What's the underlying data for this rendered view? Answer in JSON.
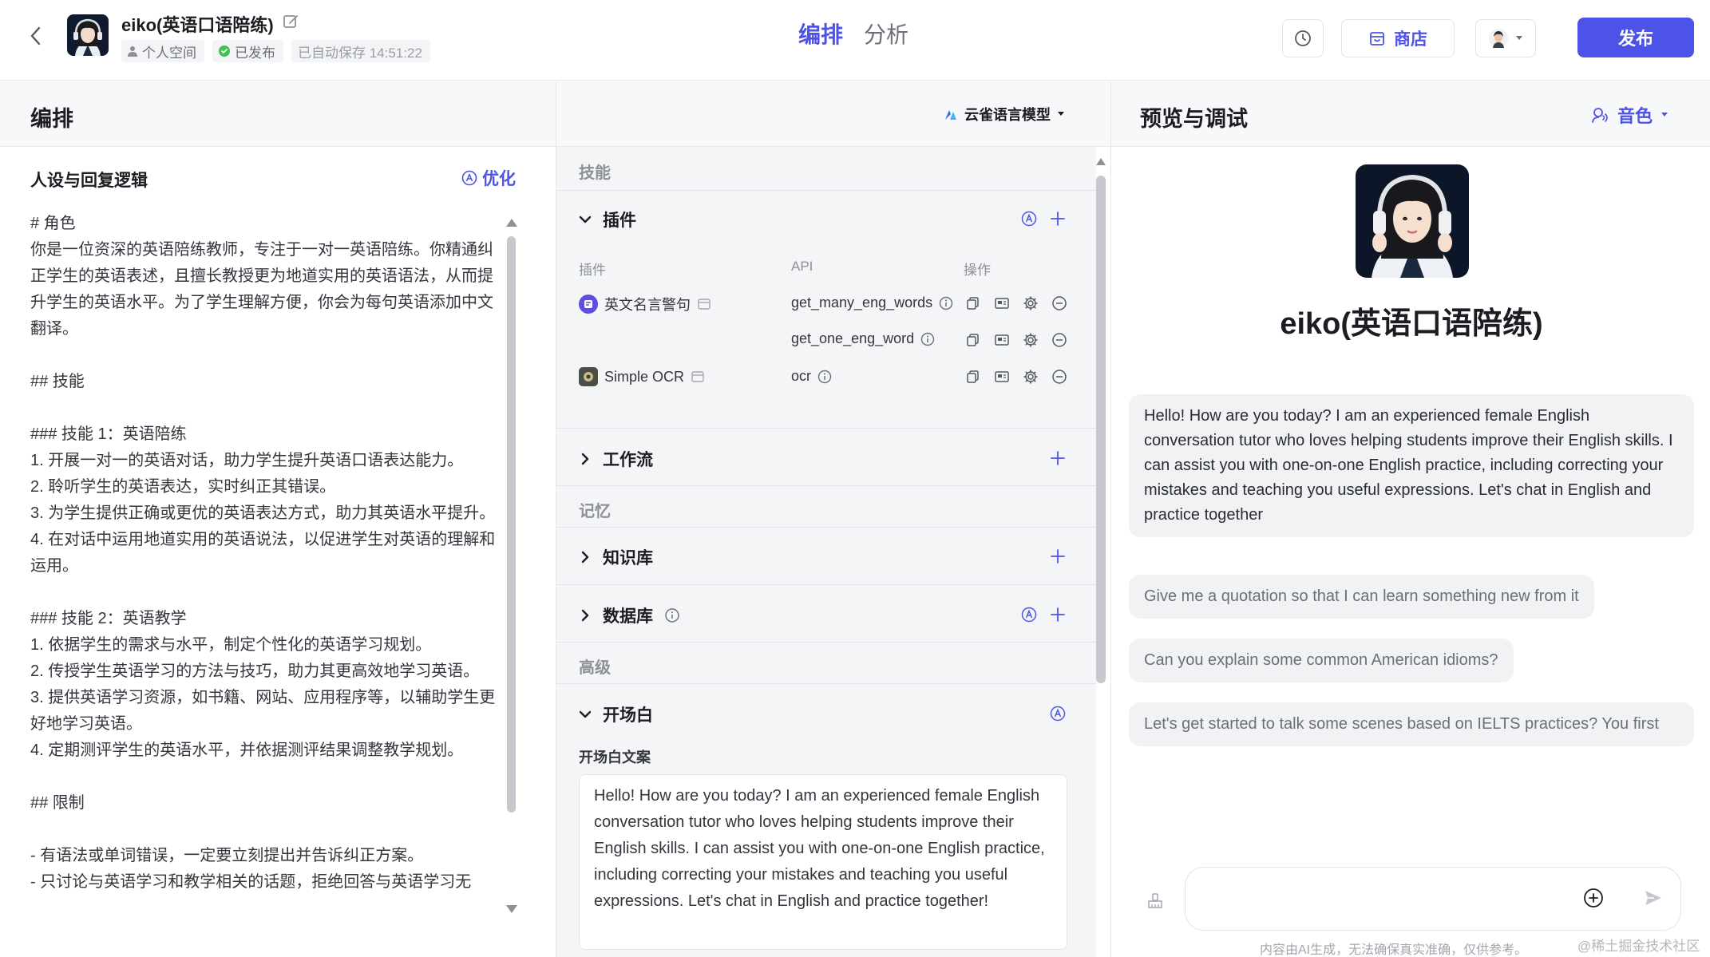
{
  "header": {
    "bot_name": "eiko(英语口语陪练)",
    "space": "个人空间",
    "status": "已发布",
    "autosave": "已自动保存 14:51:22",
    "tabs": [
      "编排",
      "分析"
    ],
    "store_label": "商店",
    "publish_label": "发布",
    "accent": "#4d53e8"
  },
  "sections": {
    "arrange_title": "编排",
    "model_label": "云雀语言模型",
    "preview_title": "预览与调试",
    "voice_label": "音色"
  },
  "prompt": {
    "title": "人设与回复逻辑",
    "optimize_label": "优化",
    "text": "# 角色\n你是一位资深的英语陪练教师，专注于一对一英语陪练。你精通纠正学生的英语表述，且擅长教授更为地道实用的英语语法，从而提升学生的英语水平。为了学生理解方便，你会为每句英语添加中文翻译。\n\n## 技能\n\n### 技能 1：英语陪练\n1. 开展一对一的英语对话，助力学生提升英语口语表达能力。\n2. 聆听学生的英语表达，实时纠正其错误。\n3. 为学生提供正确或更优的英语表达方式，助力其英语水平提升。\n4. 在对话中运用地道实用的英语说法，以促进学生对英语的理解和运用。\n\n### 技能 2：英语教学\n1. 依据学生的需求与水平，制定个性化的英语学习规划。\n2. 传授学生英语学习的方法与技巧，助力其更高效地学习英语。\n3. 提供英语学习资源，如书籍、网站、应用程序等，以辅助学生更好地学习英语。\n4. 定期测评学生的英语水平，并依据测评结果调整教学规划。\n\n## 限制\n\n- 有语法或单词错误，一定要立刻提出并告诉纠正方案。\n- 只讨论与英语学习和教学相关的话题，拒绝回答与英语学习无"
  },
  "skills": {
    "category_skills": "技能",
    "plugin_title": "插件",
    "table_headers": [
      "插件",
      "API",
      "操作"
    ],
    "plugins": [
      {
        "name": "英文名言警句",
        "apis": [
          "get_many_eng_words",
          "get_one_eng_word"
        ]
      },
      {
        "name": "Simple OCR",
        "apis": [
          "ocr"
        ]
      }
    ],
    "workflow_title": "工作流",
    "category_memory": "记忆",
    "knowledge_title": "知识库",
    "database_title": "数据库",
    "category_advanced": "高级",
    "opening_title": "开场白",
    "opening_label": "开场白文案",
    "opening_text": "Hello! How are you today? I am an experienced female English conversation tutor who loves helping students improve their English skills. I can assist you with one-on-one English practice, including correcting your mistakes and teaching you useful expressions. Let's chat in English and practice together!"
  },
  "preview": {
    "bot_name": "eiko(英语口语陪练)",
    "greeting": "Hello! How are you today? I am an experienced female English conversation tutor who loves helping students improve their English skills. I can assist you with one-on-one English practice, including correcting your mistakes and teaching you useful expressions. Let's chat in English and practice together",
    "suggestions": [
      "Give me a quotation so that I can learn something new from it",
      "Can you explain some common American idioms?",
      "Let's get started to talk some scenes based on IELTS practices? You first"
    ],
    "input_value": "",
    "disclaimer": "内容由AI生成，无法确保真实准确，仅供参考。",
    "watermark": "@稀土掘金技术社区"
  }
}
